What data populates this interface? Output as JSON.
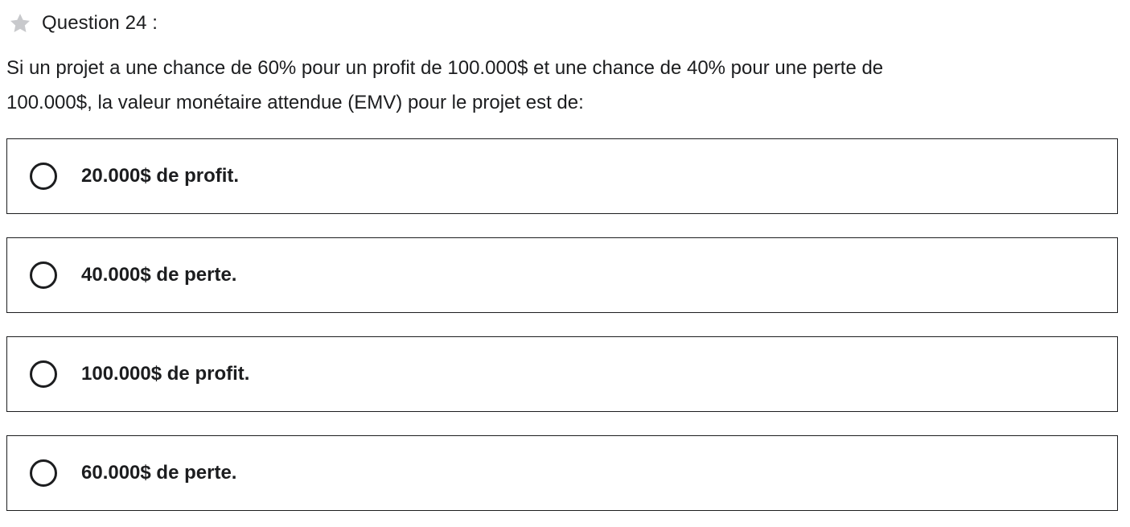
{
  "question": {
    "label": "Question 24 :",
    "star_icon": "star-icon",
    "text_line1": "Si un projet a une chance de 60% pour un profit de 100.000$ et une chance de 40% pour une perte de",
    "text_line2": "100.000$, la valeur monétaire attendue (EMV) pour le projet est de:"
  },
  "options": [
    {
      "label": "20.000$ de profit."
    },
    {
      "label": "40.000$ de perte."
    },
    {
      "label": "100.000$ de profit."
    },
    {
      "label": "60.000$ de perte."
    }
  ],
  "colors": {
    "text": "#1c1d1f",
    "star": "#c8c9cc",
    "border": "#1c1d1f",
    "background": "#ffffff"
  }
}
